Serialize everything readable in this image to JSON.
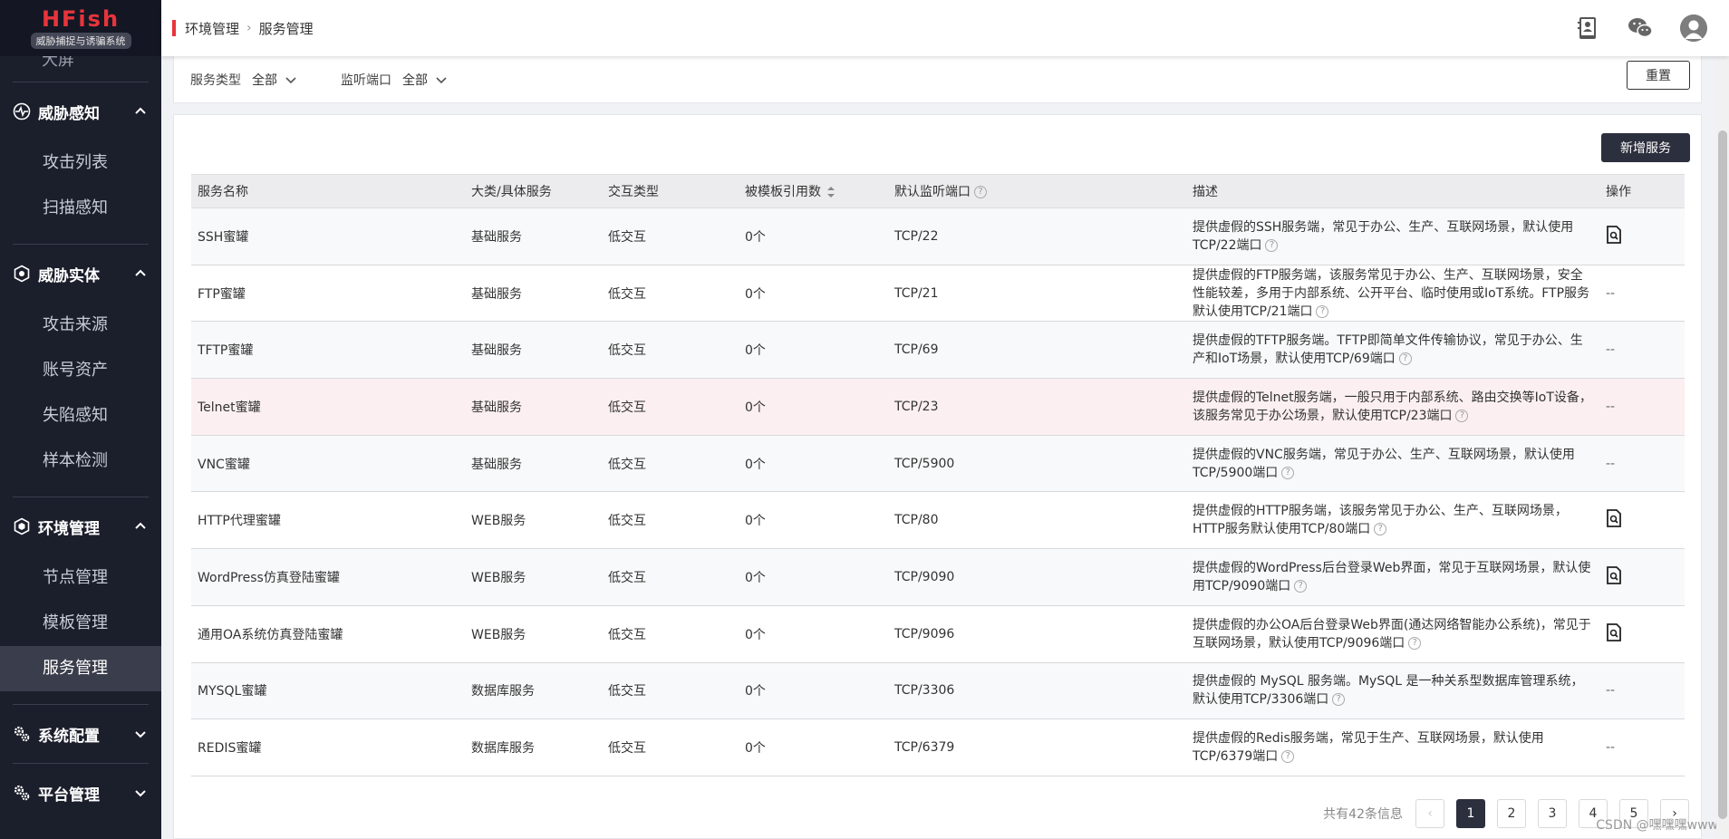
{
  "logo": {
    "main": "HFish",
    "sub": "威胁捕捉与诱骗系统"
  },
  "sidebar": {
    "partial_item": "大屏",
    "groups": [
      {
        "label": "威胁感知",
        "icon": "pulse-icon",
        "expanded": true,
        "items": [
          "攻击列表",
          "扫描感知"
        ]
      },
      {
        "label": "威胁实体",
        "icon": "shield-icon",
        "expanded": true,
        "items": [
          "攻击来源",
          "账号资产",
          "失陷感知",
          "样本检测"
        ]
      },
      {
        "label": "环境管理",
        "icon": "hexagon-icon",
        "expanded": true,
        "items": [
          "节点管理",
          "模板管理",
          "服务管理"
        ]
      },
      {
        "label": "系统配置",
        "icon": "gears-icon",
        "expanded": false,
        "items": []
      },
      {
        "label": "平台管理",
        "icon": "gears-icon",
        "expanded": false,
        "items": []
      }
    ],
    "active_item": "服务管理"
  },
  "breadcrumb": [
    "环境管理",
    "服务管理"
  ],
  "topbar_icons": [
    "contact-book-icon",
    "wechat-icon",
    "user-avatar-icon"
  ],
  "filters": {
    "service_type_label": "服务类型",
    "service_type_value": "全部",
    "port_label": "监听端口",
    "port_value": "全部",
    "reset": "重置"
  },
  "add_button": "新增服务",
  "table": {
    "headers": [
      "服务名称",
      "大类/具体服务",
      "交互类型",
      "被模板引用数",
      "默认监听端口",
      "描述",
      "操作"
    ],
    "rows": [
      {
        "name": "SSH蜜罐",
        "category": "基础服务",
        "interaction": "低交互",
        "refs": "0个",
        "port": "TCP/22",
        "desc": "提供虚假的SSH服务端，常见于办公、生产、互联网场景，默认使用TCP/22端口",
        "op": "icon"
      },
      {
        "name": "FTP蜜罐",
        "category": "基础服务",
        "interaction": "低交互",
        "refs": "0个",
        "port": "TCP/21",
        "desc": "提供虚假的FTP服务端，该服务常见于办公、生产、互联网场景，安全性能较差，多用于内部系统、公开平台、临时使用或IoT系统。FTP服务默认使用TCP/21端口",
        "op": "--"
      },
      {
        "name": "TFTP蜜罐",
        "category": "基础服务",
        "interaction": "低交互",
        "refs": "0个",
        "port": "TCP/69",
        "desc": "提供虚假的TFTP服务端。TFTP即简单文件传输协议，常见于办公、生产和IoT场景，默认使用TCP/69端口",
        "op": "--"
      },
      {
        "name": "Telnet蜜罐",
        "category": "基础服务",
        "interaction": "低交互",
        "refs": "0个",
        "port": "TCP/23",
        "desc": "提供虚假的Telnet服务端，一般只用于内部系统、路由交换等IoT设备，该服务常见于办公场景，默认使用TCP/23端口",
        "op": "--"
      },
      {
        "name": "VNC蜜罐",
        "category": "基础服务",
        "interaction": "低交互",
        "refs": "0个",
        "port": "TCP/5900",
        "desc": "提供虚假的VNC服务端，常见于办公、生产、互联网场景，默认使用TCP/5900端口",
        "op": "--"
      },
      {
        "name": "HTTP代理蜜罐",
        "category": "WEB服务",
        "interaction": "低交互",
        "refs": "0个",
        "port": "TCP/80",
        "desc": "提供虚假的HTTP服务端，该服务常见于办公、生产、互联网场景，HTTP服务默认使用TCP/80端口",
        "op": "icon"
      },
      {
        "name": "WordPress仿真登陆蜜罐",
        "category": "WEB服务",
        "interaction": "低交互",
        "refs": "0个",
        "port": "TCP/9090",
        "desc": "提供虚假的WordPress后台登录Web界面，常见于互联网场景，默认使用TCP/9090端口",
        "op": "icon"
      },
      {
        "name": "通用OA系统仿真登陆蜜罐",
        "category": "WEB服务",
        "interaction": "低交互",
        "refs": "0个",
        "port": "TCP/9096",
        "desc": "提供虚假的办公OA后台登录Web界面(通达网络智能办公系统)，常见于互联网场景，默认使用TCP/9096端口",
        "op": "icon"
      },
      {
        "name": "MYSQL蜜罐",
        "category": "数据库服务",
        "interaction": "低交互",
        "refs": "0个",
        "port": "TCP/3306",
        "desc": "提供虚假的 MySQL 服务端。MySQL 是一种关系型数据库管理系统，默认使用TCP/3306端口",
        "op": "--"
      },
      {
        "name": "REDIS蜜罐",
        "category": "数据库服务",
        "interaction": "低交互",
        "refs": "0个",
        "port": "TCP/6379",
        "desc": "提供虚假的Redis服务端，常见于生产、互联网场景，默认使用TCP/6379端口",
        "op": "--"
      }
    ],
    "highlighted_row": 3
  },
  "pagination": {
    "total": "共有42条信息",
    "pages": [
      "1",
      "2",
      "3",
      "4",
      "5"
    ],
    "current": "1",
    "prev": "‹",
    "next": "›"
  },
  "watermark": "CSDN @嘿嘿嘿www"
}
